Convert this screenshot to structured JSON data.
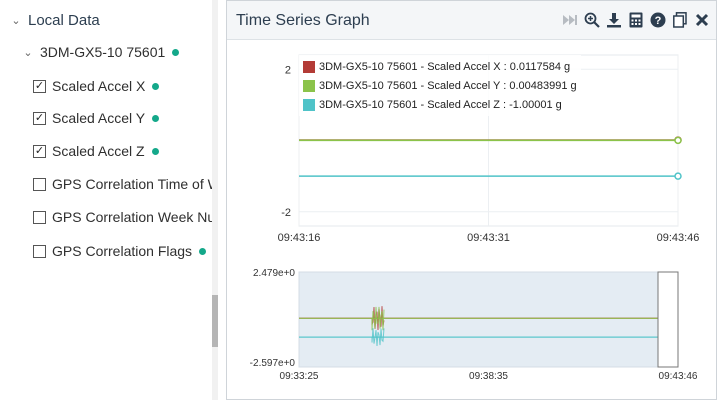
{
  "tree": {
    "root_label": "Local Data",
    "device_label": "3DM-GX5-10 75601",
    "items": [
      {
        "label": "Scaled Accel X",
        "checked": true,
        "dot": true
      },
      {
        "label": "Scaled Accel Y",
        "checked": true,
        "dot": true
      },
      {
        "label": "Scaled Accel Z",
        "checked": true,
        "dot": true
      },
      {
        "label": "GPS Correlation Time of Week",
        "checked": false,
        "dot": false
      },
      {
        "label": "GPS Correlation Week Number",
        "checked": false,
        "dot": false
      },
      {
        "label": "GPS Correlation Flags",
        "checked": false,
        "dot": true
      }
    ]
  },
  "graph": {
    "title": "Time Series Graph",
    "toolbar_icons": [
      "pause-skip-icon",
      "zoom-in-icon",
      "download-icon",
      "calculator-icon",
      "help-icon",
      "copy-icon",
      "close-icon"
    ]
  },
  "colors": {
    "accel_x": "#b33b36",
    "accel_y": "#8bc34a",
    "accel_z": "#4fc3c8",
    "status_dot": "#14a88a"
  },
  "chart_data": [
    {
      "type": "line",
      "series": [
        {
          "name": "3DM-GX5-10 75601 - Scaled Accel X : 0.0117584 g",
          "y": 0.0117584
        },
        {
          "name": "3DM-GX5-10 75601 - Scaled Accel Y : 0.00483991 g",
          "y": 0.00483991
        },
        {
          "name": "3DM-GX5-10 75601 - Scaled Accel Z : -1.00001 g",
          "y": -1.00001
        }
      ],
      "y_ticks": [
        "2",
        "-2"
      ],
      "ylim": [
        -2.4,
        2.4
      ],
      "x_ticks": [
        "09:43:16",
        "09:43:31",
        "09:43:46"
      ],
      "grid": true,
      "legend": "top-left"
    },
    {
      "type": "line",
      "y_ticks": [
        "2.479e+0",
        "-2.597e+0"
      ],
      "ylim": [
        -2.597,
        2.479
      ],
      "x_ticks": [
        "09:33:25",
        "09:38:35",
        "09:43:46"
      ]
    }
  ]
}
